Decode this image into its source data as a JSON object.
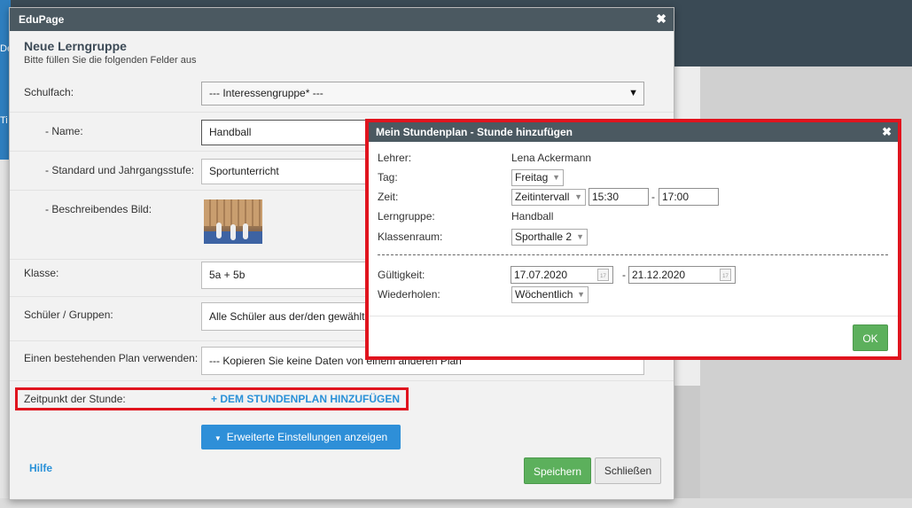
{
  "background": {
    "frag_1": "De",
    "frag_2": "Ti"
  },
  "dialog": {
    "title": "EduPage",
    "close_glyph": "✖",
    "heading": "Neue Lerngruppe",
    "subheading": "Bitte füllen Sie die folgenden Felder aus",
    "rows": {
      "schulfach": {
        "label": "Schulfach:",
        "value": "--- Interessengruppe* ---"
      },
      "name": {
        "label": "- Name:",
        "value": "Handball"
      },
      "standard": {
        "label": "- Standard und Jahrgangsstufe:",
        "value": "Sportunterricht"
      },
      "bild": {
        "label": "- Beschreibendes Bild:"
      },
      "klasse": {
        "label": "Klasse:",
        "value": "5a + 5b"
      },
      "schueler": {
        "label": "Schüler / Gruppen:",
        "value": "Alle Schüler aus der/den gewählten"
      },
      "plan": {
        "label": "Einen bestehenden Plan verwenden:",
        "value": "--- Kopieren Sie keine Daten von einem anderen Plan"
      },
      "zeitpunkt": {
        "label": "Zeitpunkt der Stunde:",
        "link": "+ DEM STUNDENPLAN HINZUFÜGEN"
      }
    },
    "advanced_button": "Erweiterte Einstellungen anzeigen",
    "advanced_icon": "▼",
    "help_link": "Hilfe",
    "save_button": "Speichern",
    "close_button": "Schließen"
  },
  "popup": {
    "title": "Mein Stundenplan - Stunde hinzufügen",
    "close_glyph": "✖",
    "lehrer_label": "Lehrer:",
    "lehrer_value": "Lena Ackermann",
    "tag_label": "Tag:",
    "tag_value": "Freitag",
    "zeit_label": "Zeit:",
    "zeit_mode": "Zeitintervall",
    "zeit_from": "15:30",
    "zeit_to": "17:00",
    "lerngruppe_label": "Lerngruppe:",
    "lerngruppe_value": "Handball",
    "raum_label": "Klassenraum:",
    "raum_value": "Sporthalle 2",
    "gueltig_label": "Gültigkeit:",
    "gueltig_from": "17.07.2020",
    "gueltig_to": "21.12.2020",
    "wiederholen_label": "Wiederholen:",
    "wiederholen_value": "Wöchentlich",
    "dash": "-",
    "cal_glyph": "17",
    "ok_button": "OK"
  },
  "colors": {
    "titlebar": "#4b5961",
    "primary": "#2e8fd8",
    "success": "#5cb05c",
    "highlight": "#e0141e"
  }
}
